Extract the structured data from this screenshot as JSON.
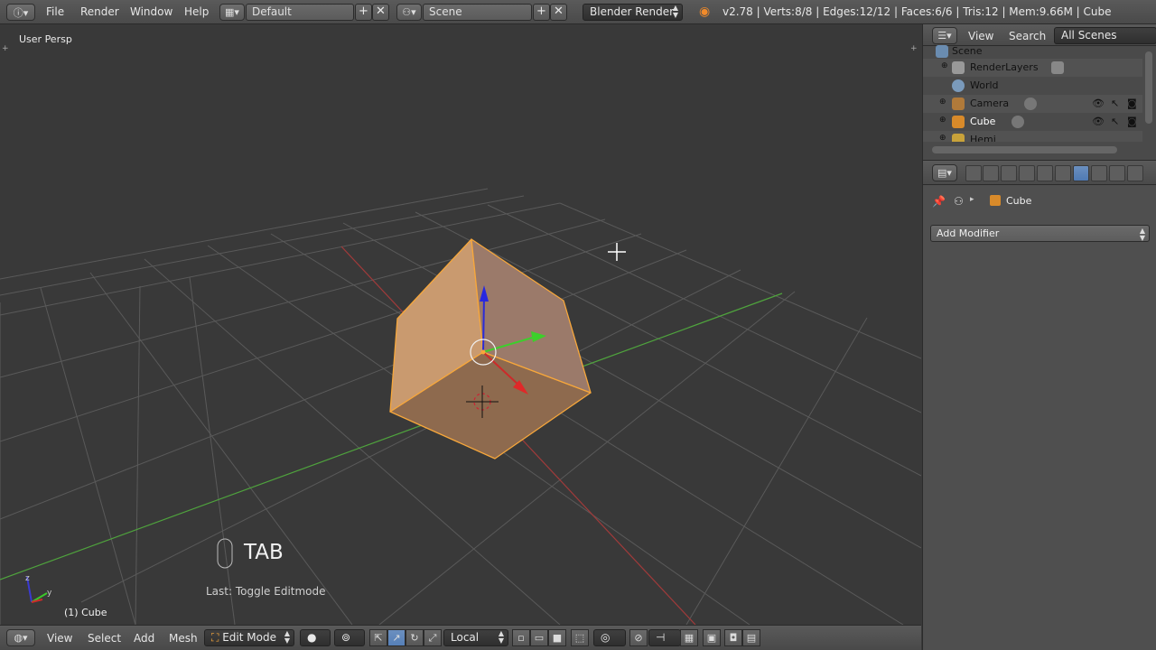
{
  "topbar": {
    "menus": [
      "File",
      "Render",
      "Window",
      "Help"
    ],
    "screen_layout": "Default",
    "scene": "Scene",
    "render_engine": "Blender Render",
    "stats": "v2.78 | Verts:8/8 | Edges:12/12 | Faces:6/6 | Tris:12 | Mem:9.66M | Cube"
  },
  "viewport": {
    "view_label": "User Persp",
    "key_pressed": "TAB",
    "last_operator": "Last: Toggle Editmode",
    "object_name": "(1) Cube",
    "colors": {
      "background": "#393939",
      "grid": "#555555",
      "selection": "#f7a73b",
      "x_axis": "#b33a3a",
      "y_axis": "#4fa33d"
    }
  },
  "bottombar": {
    "menus": [
      "View",
      "Select",
      "Add",
      "Mesh"
    ],
    "mode": "Edit Mode",
    "pivot": "Local"
  },
  "outliner": {
    "header": {
      "view": "View",
      "search": "Search",
      "filter": "All Scenes"
    },
    "rows": [
      {
        "label": "Scene"
      },
      {
        "label": "RenderLayers"
      },
      {
        "label": "World"
      },
      {
        "label": "Camera"
      },
      {
        "label": "Cube"
      },
      {
        "label": "Hemi"
      }
    ]
  },
  "properties": {
    "context_object": "Cube",
    "add_modifier": "Add Modifier"
  }
}
